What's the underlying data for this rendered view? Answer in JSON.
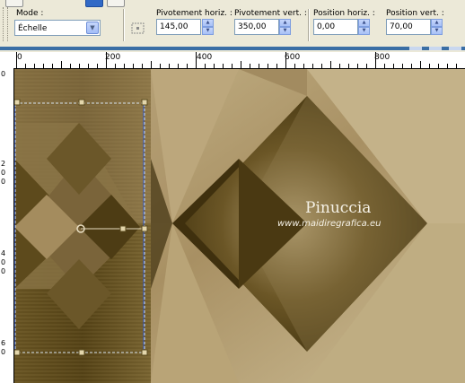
{
  "toolbar": {
    "mode_label": "Mode :",
    "mode_value": "Échelle",
    "pivot_h_label": "Pivotement horiz. :",
    "pivot_h_value": "145,00",
    "pivot_v_label": "Pivotement vert. :",
    "pivot_v_value": "350,00",
    "pos_h_label": "Position horiz. :",
    "pos_h_value": "0,00",
    "pos_v_label": "Position vert. :",
    "pos_v_value": "70,00"
  },
  "ruler": {
    "labels": [
      "0",
      "200",
      "400",
      "600",
      "800"
    ],
    "vertical_labels": [
      "0",
      "2",
      "0",
      "0",
      "4",
      "0",
      "0",
      "6",
      "0"
    ]
  },
  "watermark": {
    "name": "Pinuccia",
    "url": "www.maidiregrafica.eu"
  },
  "colors": {
    "accent_blue": "#3a6ea5",
    "image_dark": "#4a3a12",
    "image_light": "#c6b488"
  },
  "icons": [
    "dropdown-arrow-icon",
    "pick-tool-icon",
    "spin-up-icon",
    "spin-down-icon"
  ]
}
